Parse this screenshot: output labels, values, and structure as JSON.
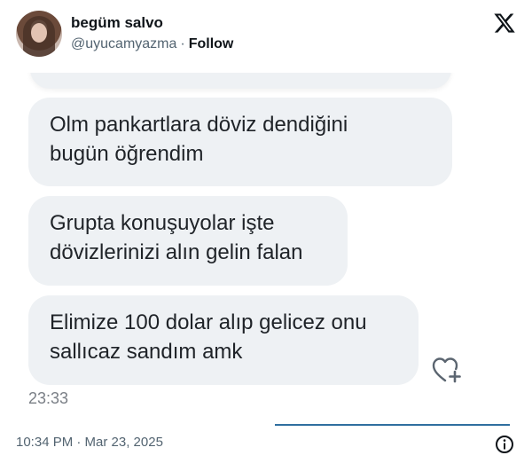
{
  "tweet": {
    "author_name": "begüm salvo",
    "author_handle": "@uyucamyazma",
    "separator": "·",
    "follow_label": "Follow",
    "timestamp": "10:34 PM · Mar 23, 2025"
  },
  "screenshot": {
    "messages": [
      {
        "text": "Olm pankartlara döviz dendiğini\nbugün öğrendim"
      },
      {
        "text": "Grupta konuşuyolar işte\ndövizlerinizi alın gelin falan"
      },
      {
        "text": "Elimize 100 dolar alıp gelicez onu\nsallıcaz sandım amk"
      }
    ],
    "message_time": "23:33"
  },
  "icons": {
    "logo": "x-logo-icon",
    "react": "heart-plus-icon",
    "info": "info-icon"
  },
  "colors": {
    "bubble_bg": "#eef1f4",
    "text_primary": "#0f1419",
    "text_secondary": "#536471"
  }
}
